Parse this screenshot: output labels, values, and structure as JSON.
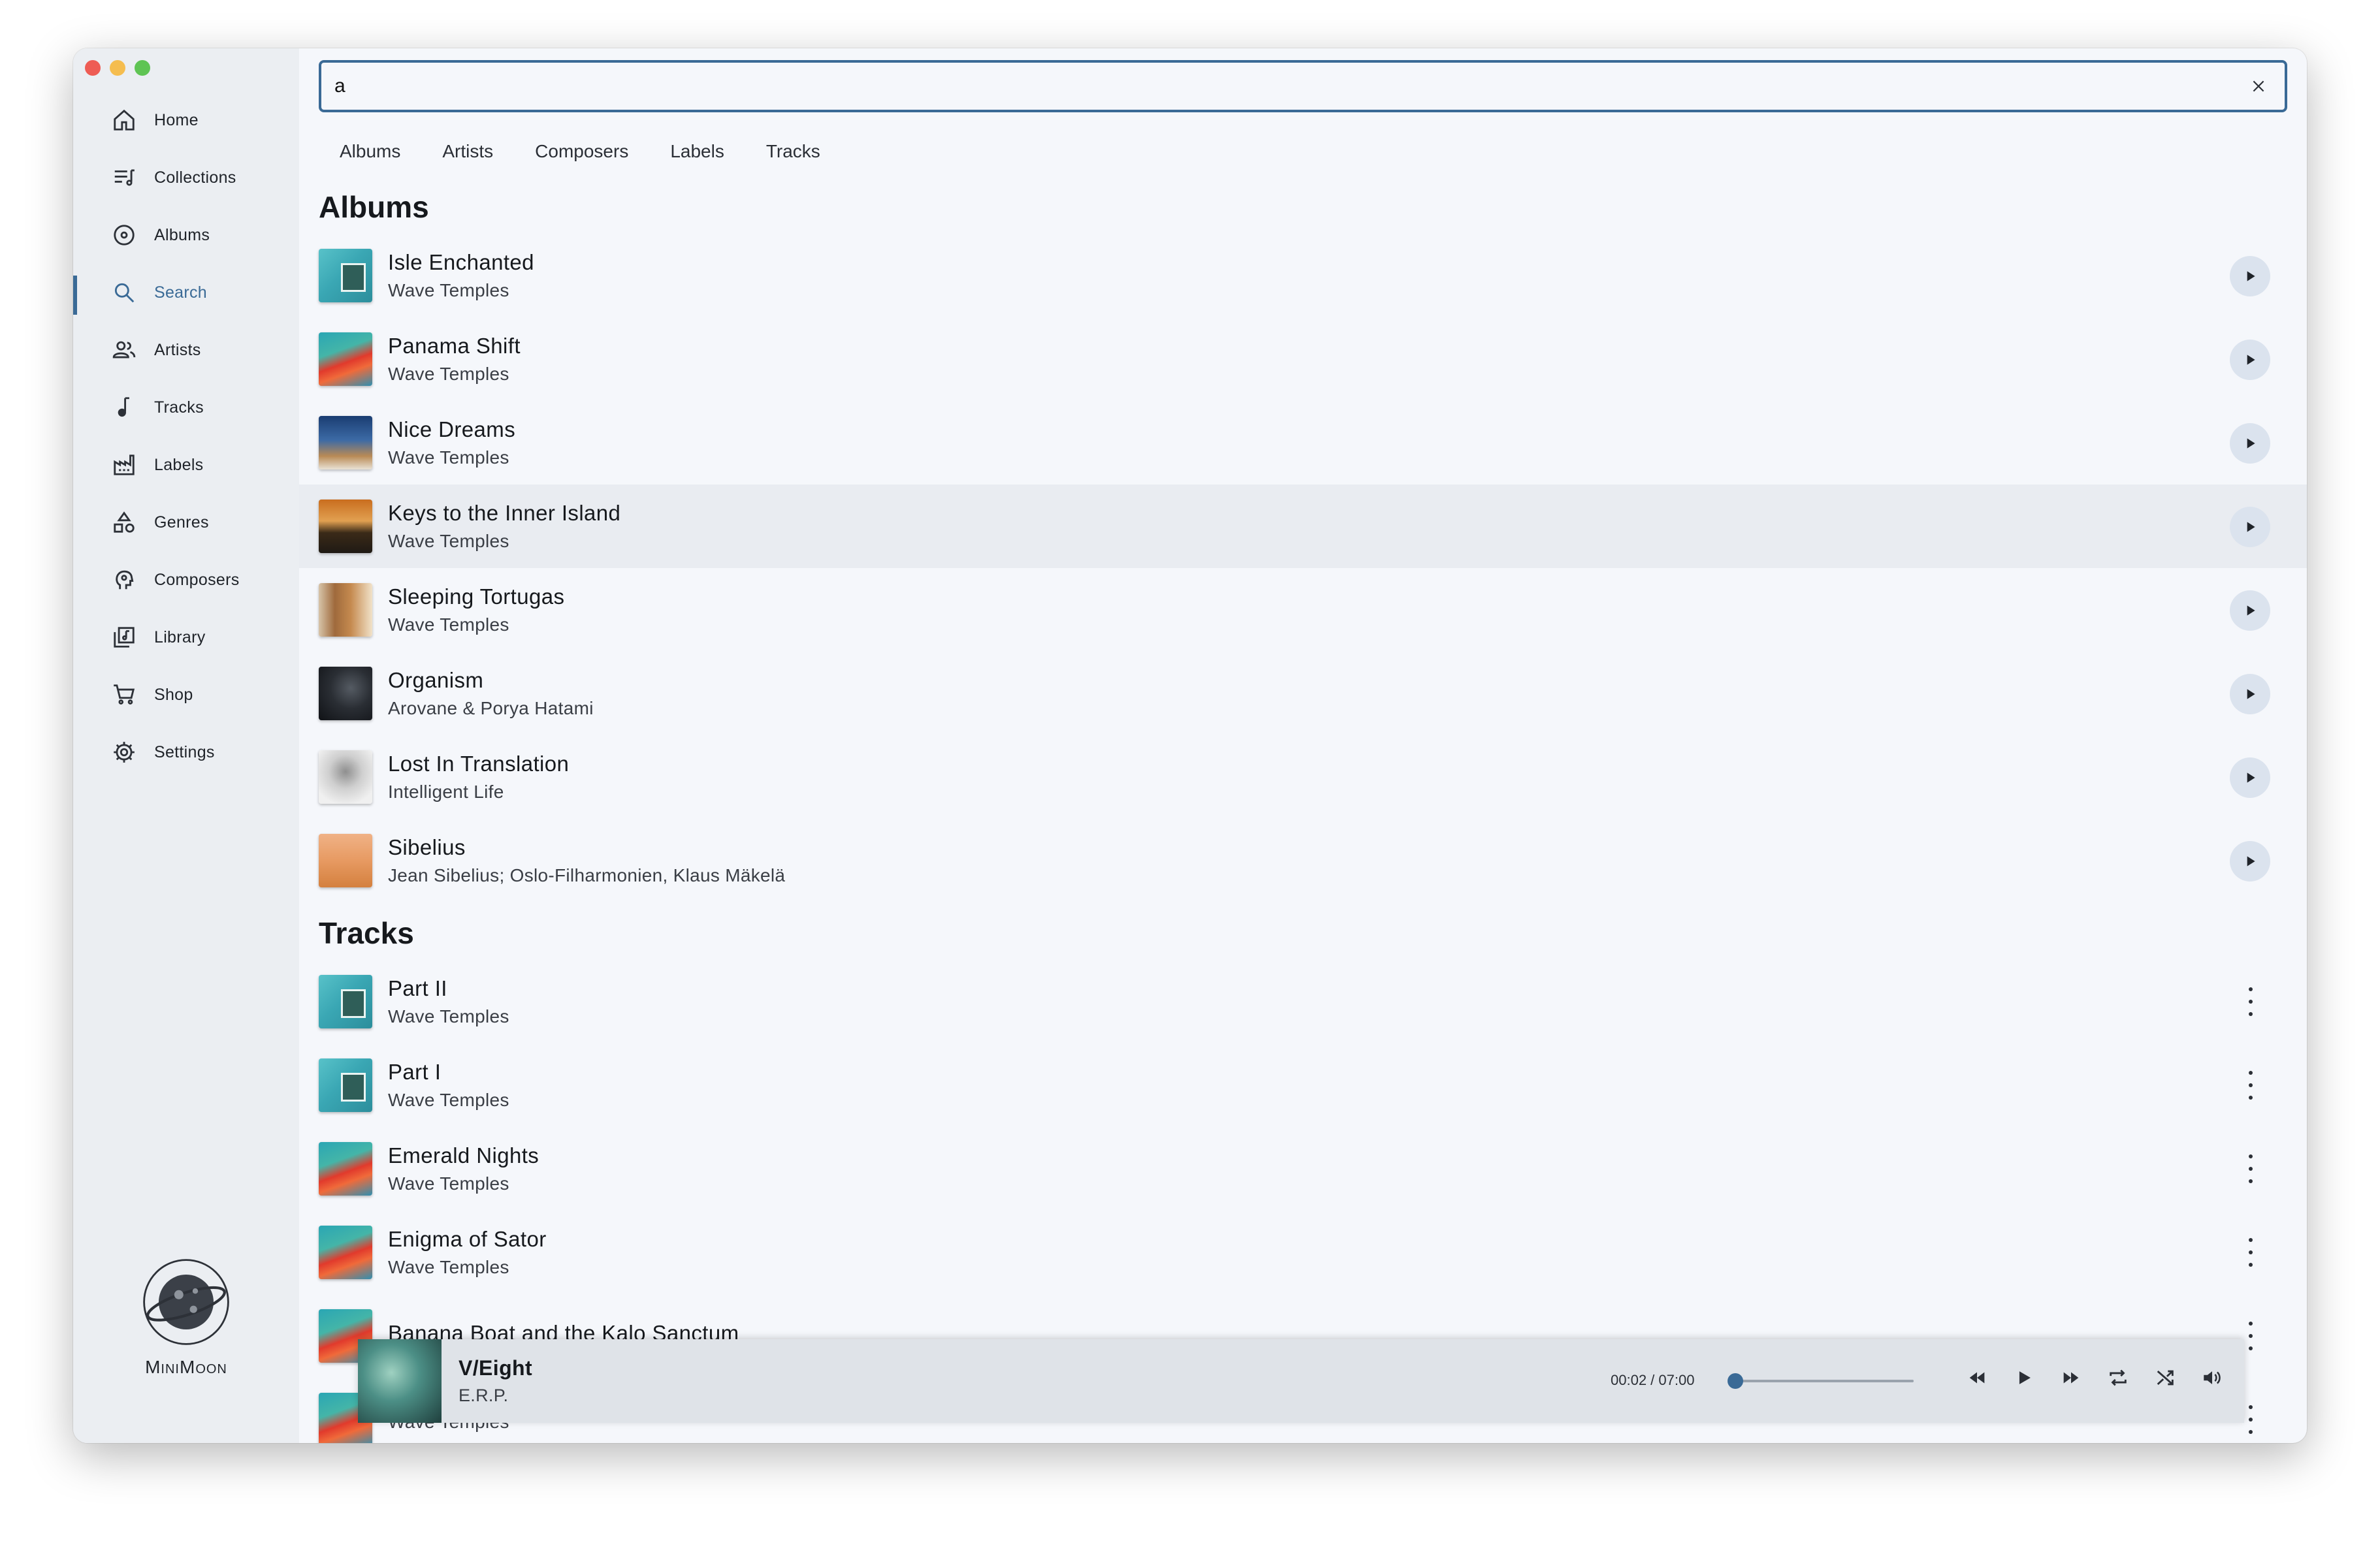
{
  "sidebar": {
    "items": [
      {
        "label": "Home",
        "icon": "home-icon"
      },
      {
        "label": "Collections",
        "icon": "playlist-icon"
      },
      {
        "label": "Albums",
        "icon": "disc-icon"
      },
      {
        "label": "Search",
        "icon": "search-icon",
        "active": true
      },
      {
        "label": "Artists",
        "icon": "people-icon"
      },
      {
        "label": "Tracks",
        "icon": "music-note-icon"
      },
      {
        "label": "Labels",
        "icon": "factory-icon"
      },
      {
        "label": "Genres",
        "icon": "shapes-icon"
      },
      {
        "label": "Composers",
        "icon": "head-icon"
      },
      {
        "label": "Library",
        "icon": "library-icon"
      },
      {
        "label": "Shop",
        "icon": "cart-icon"
      },
      {
        "label": "Settings",
        "icon": "gear-icon"
      }
    ],
    "brand": "MiniMoon"
  },
  "search": {
    "value": "a",
    "placeholder": ""
  },
  "tabs": [
    "Albums",
    "Artists",
    "Composers",
    "Labels",
    "Tracks"
  ],
  "albums": {
    "heading": "Albums",
    "items": [
      {
        "title": "Isle Enchanted",
        "artist": "Wave Temples",
        "cover": "teal"
      },
      {
        "title": "Panama Shift",
        "artist": "Wave Temples",
        "cover": "parrot"
      },
      {
        "title": "Nice Dreams",
        "artist": "Wave Temples",
        "cover": "sky"
      },
      {
        "title": "Keys to the Inner Island",
        "artist": "Wave Temples",
        "cover": "palm"
      },
      {
        "title": "Sleeping Tortugas",
        "artist": "Wave Temples",
        "cover": "sepia"
      },
      {
        "title": "Organism",
        "artist": "Arovane & Porya Hatami",
        "cover": "dark"
      },
      {
        "title": "Lost In Translation",
        "artist": "Intelligent Life",
        "cover": "tree"
      },
      {
        "title": "Sibelius",
        "artist": "Jean Sibelius; Oslo-Filharmonien, Klaus Mäkelä",
        "cover": "face"
      }
    ]
  },
  "tracks": {
    "heading": "Tracks",
    "items": [
      {
        "title": "Part II",
        "artist": "Wave Temples",
        "cover": "teal"
      },
      {
        "title": "Part I",
        "artist": "Wave Temples",
        "cover": "teal"
      },
      {
        "title": "Emerald Nights",
        "artist": "Wave Temples",
        "cover": "parrot"
      },
      {
        "title": "Enigma of Sator",
        "artist": "Wave Temples",
        "cover": "parrot"
      },
      {
        "title": "Banana Boat and the Kalo Sanctum",
        "artist": "",
        "cover": "parrot"
      },
      {
        "title": "",
        "artist": "Wave Temples",
        "cover": "parrot"
      }
    ]
  },
  "player": {
    "title": "V/Eight",
    "artist": "E.R.P.",
    "time": "00:02 / 07:00",
    "progress": 0.005,
    "controls": [
      "rewind-icon",
      "play-icon",
      "fast-forward-icon",
      "repeat-icon",
      "shuffle-icon",
      "volume-icon"
    ]
  },
  "colors": {
    "accent": "#3a6a96",
    "sidebar_bg": "#ebeef2",
    "main_bg": "#f5f7fb"
  }
}
